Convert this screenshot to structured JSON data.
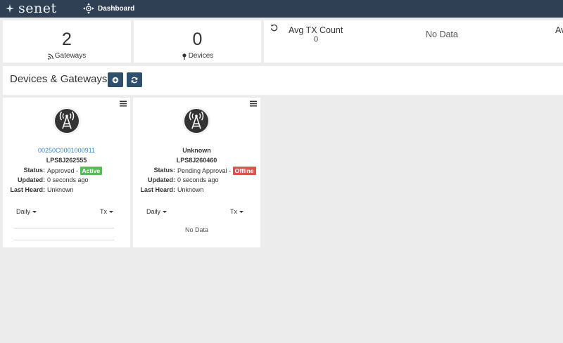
{
  "brand": {
    "name": "senet"
  },
  "nav": {
    "dashboard_label": "Dashboard"
  },
  "stats": {
    "gateways": {
      "value": "2",
      "label": "Gateways",
      "icon": "rss-icon"
    },
    "devices": {
      "value": "0",
      "label": "Devices",
      "icon": "map-marker-icon"
    },
    "avg_tx": {
      "title": "Avg TX Count",
      "value": "0",
      "no_data": "No Data",
      "cut_title": "Av"
    }
  },
  "section": {
    "title": "Devices & Gateways"
  },
  "cards": [
    {
      "eui": "00250C0001000911",
      "serial": "LPS8J262555",
      "status_label": "Status:",
      "status_text": "Approved -",
      "badge": "Active",
      "badge_color": "#5cb85c",
      "updated_label": "Updated:",
      "updated": "0 seconds ago",
      "last_heard_label": "Last Heard:",
      "last_heard": "Unknown",
      "period": "Daily",
      "metric": "Tx"
    },
    {
      "eui": "Unknown",
      "serial": "LPS8J260460",
      "status_label": "Status:",
      "status_text": "Pending Approval -",
      "badge": "Offline",
      "badge_color": "#d9534f",
      "updated_label": "Updated:",
      "updated": "0 seconds ago",
      "last_heard_label": "Last Heard:",
      "last_heard": "Unknown",
      "period": "Daily",
      "metric": "Tx",
      "no_data": "No Data"
    }
  ],
  "colors": {
    "nav": "#2f3f54",
    "button": "#2f4f6e",
    "link": "#3b7fbf"
  }
}
